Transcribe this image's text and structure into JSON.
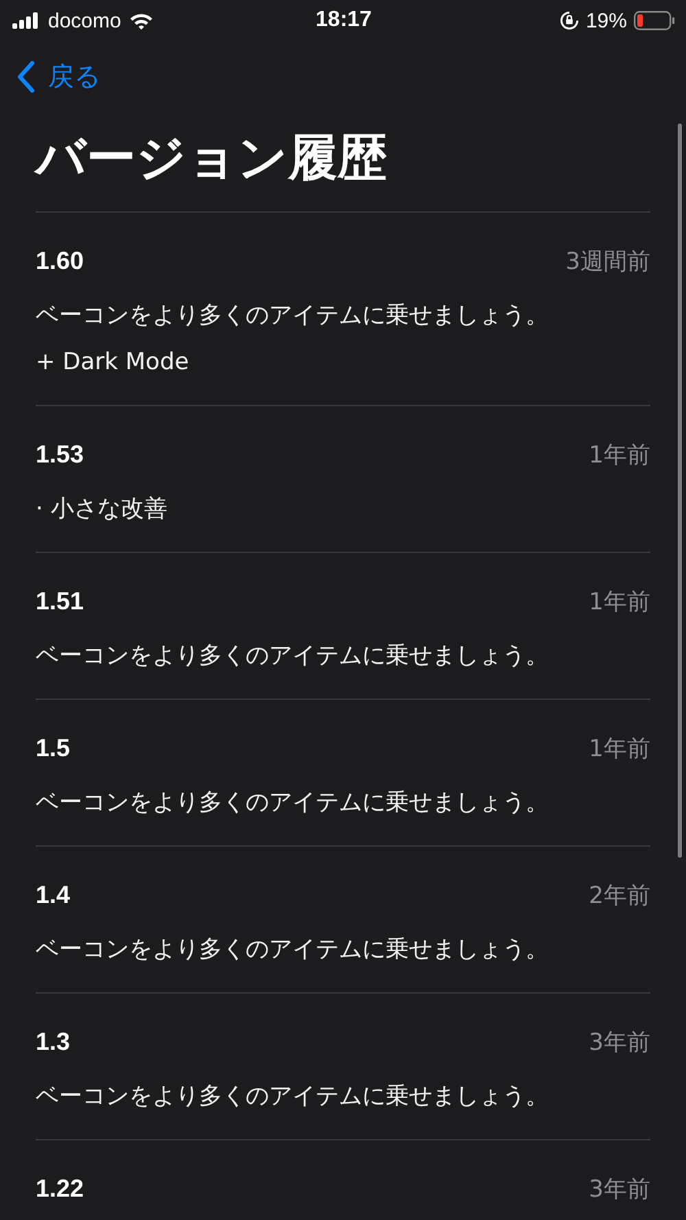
{
  "status_bar": {
    "carrier": "docomo",
    "time": "18:17",
    "battery": "19%"
  },
  "nav": {
    "back": "戻る"
  },
  "title": "バージョン履歴",
  "versions": [
    {
      "version": "1.60",
      "date": "3週間前",
      "notes": [
        "ベーコンをより多くのアイテムに乗せましょう。",
        "+ Dark Mode"
      ]
    },
    {
      "version": "1.53",
      "date": "1年前",
      "notes": [
        "· 小さな改善"
      ]
    },
    {
      "version": "1.51",
      "date": "1年前",
      "notes": [
        "ベーコンをより多くのアイテムに乗せましょう。"
      ]
    },
    {
      "version": "1.5",
      "date": "1年前",
      "notes": [
        "ベーコンをより多くのアイテムに乗せましょう。"
      ]
    },
    {
      "version": "1.4",
      "date": "2年前",
      "notes": [
        "ベーコンをより多くのアイテムに乗せましょう。"
      ]
    },
    {
      "version": "1.3",
      "date": "3年前",
      "notes": [
        "ベーコンをより多くのアイテムに乗せましょう。"
      ]
    },
    {
      "version": "1.22",
      "date": "3年前"
    }
  ]
}
